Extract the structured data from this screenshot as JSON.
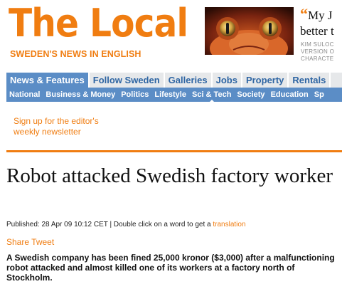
{
  "brand": {
    "title": "The Local",
    "tagline": "SWEDEN'S NEWS IN ENGLISH",
    "color": "#f07d11"
  },
  "ad": {
    "quote": "My J better t",
    "line1": "My J",
    "line2": "better t",
    "small_line1": "KIM SULOC",
    "small_line2": "VERSION O",
    "small_line3": "CHARACTE"
  },
  "nav": {
    "main": [
      "News & Features",
      "Follow Sweden",
      "Galleries",
      "Jobs",
      "Property",
      "Rentals"
    ],
    "active_main": "News & Features",
    "sub": [
      "National",
      "Business & Money",
      "Politics",
      "Lifestyle",
      "Sci & Tech",
      "Society",
      "Education",
      "Sp"
    ],
    "active_sub": "Sci & Tech",
    "main_bg": "#e6e8ea",
    "sub_bg": "#5b8dc6"
  },
  "signup": {
    "line1": "Sign up for the editor's",
    "line2": "weekly newsletter"
  },
  "article": {
    "headline": "Robot attacked Swedish factory worker",
    "published_prefix": "Published: 28 Apr 09 10:12 CET | Double click on a word to get a ",
    "translation_link": "translation",
    "share": "Share",
    "tweet": "Tweet",
    "lede": "A Swedish company has been fined 25,000 kronor ($3,000) after a malfunctioning robot attacked and almost killed one of its workers at a factory north of Stockholm."
  }
}
